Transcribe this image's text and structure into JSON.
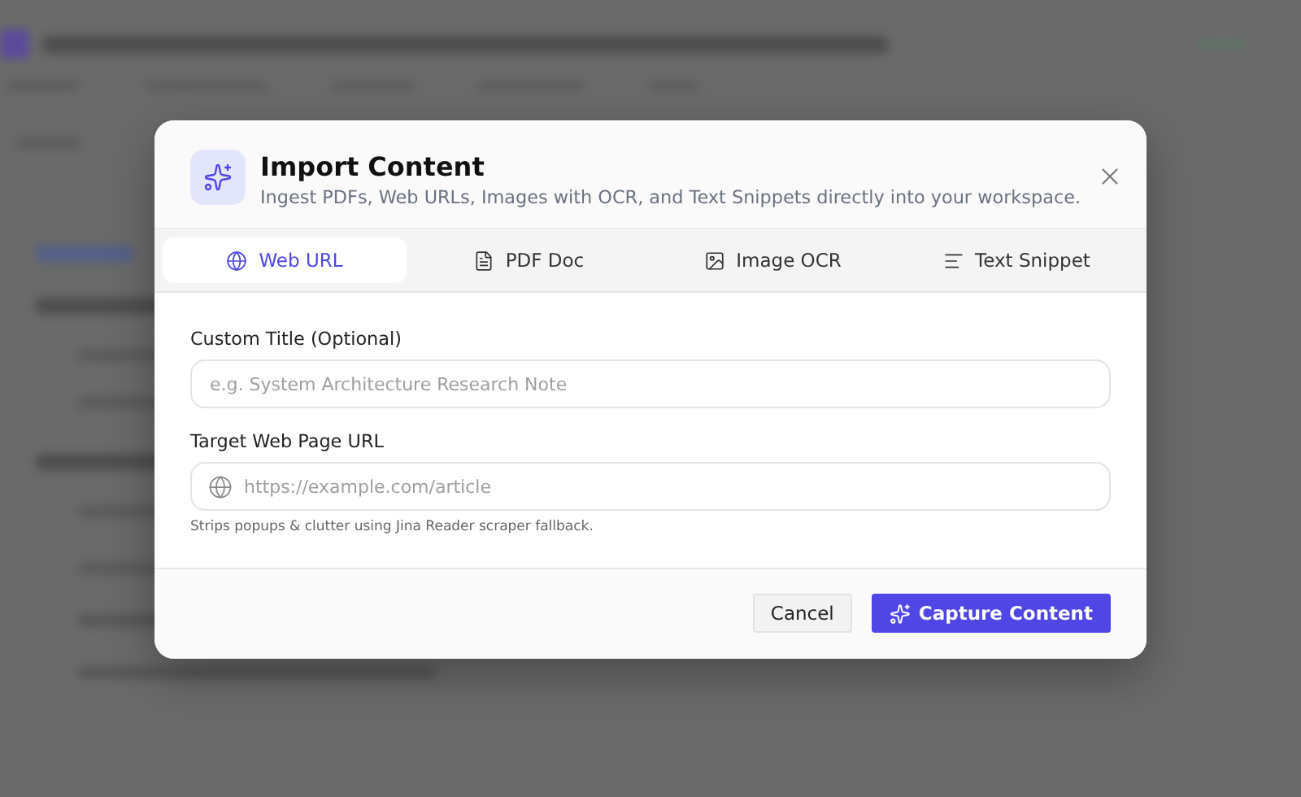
{
  "dialog": {
    "title": "Import Content",
    "subtitle": "Ingest PDFs, Web URLs, Images with OCR, and Text Snippets directly into your workspace.",
    "tabs": [
      {
        "kind": "globe",
        "label": "Web URL",
        "selected": true
      },
      {
        "kind": "file",
        "label": "PDF Doc",
        "selected": false
      },
      {
        "kind": "image",
        "label": "Image OCR",
        "selected": false
      },
      {
        "kind": "lines",
        "label": "Text Snippet",
        "selected": false
      }
    ],
    "fields": [
      {
        "kind": "text",
        "label": "Custom Title (Optional)",
        "placeholder": "e.g. System Architecture Research Note"
      },
      {
        "kind": "url",
        "label": "Target Web Page URL",
        "placeholder": "https://example.com/article",
        "hint": "Strips popups & clutter using Jina Reader scraper fallback."
      }
    ],
    "buttons": [
      {
        "kind": "secondary",
        "label": "Cancel"
      },
      {
        "kind": "primary",
        "label": "Capture Content"
      }
    ]
  }
}
